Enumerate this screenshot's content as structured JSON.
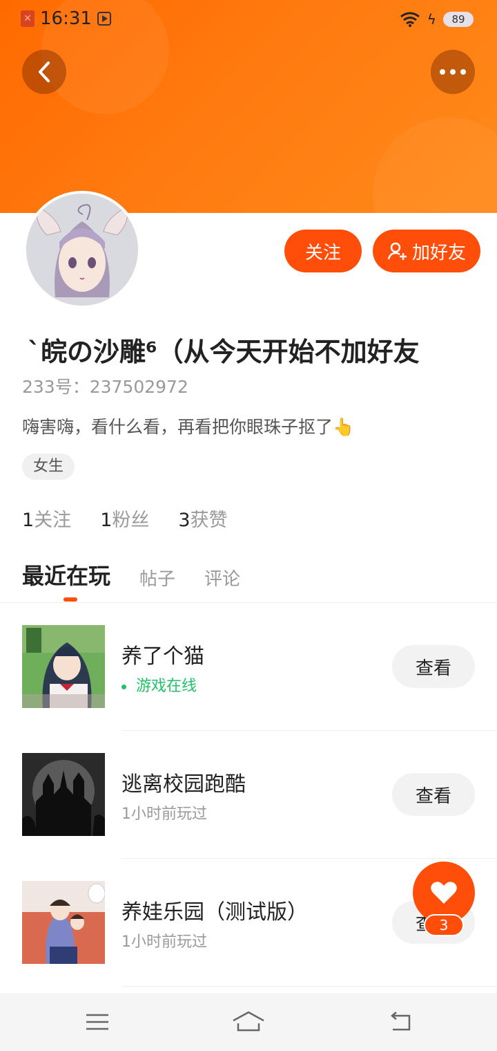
{
  "status_bar": {
    "time": "16:31",
    "battery": "89"
  },
  "profile": {
    "nickname": "ˋ皖の沙雕⁶（从今天开始不加好友",
    "uid": "233号：237502972",
    "bio": "嗨害嗨，看什么看，再看把你眼珠子抠了👆",
    "gender_tag": "女生",
    "follow_label": "关注",
    "add_friend_label": "加好友",
    "stats": [
      {
        "num": "1",
        "label": "关注"
      },
      {
        "num": "1",
        "label": "粉丝"
      },
      {
        "num": "3",
        "label": "获赞"
      }
    ]
  },
  "tabs": [
    "最近在玩",
    "帖子",
    "评论"
  ],
  "games": [
    {
      "title": "养了个猫",
      "sub": "游戏在线",
      "button": "查看"
    },
    {
      "title": "逃离校园跑酷",
      "sub": "1小时前玩过",
      "button": "查看"
    },
    {
      "title": "养娃乐园（测试版）",
      "sub": "1小时前玩过",
      "button": "查看"
    }
  ],
  "likes_count": "3",
  "icons": {
    "back": "chevron-left-icon",
    "more": "more-dots-icon",
    "add_friend": "add-user-icon",
    "heart": "heart-icon",
    "nav": [
      "menu-icon",
      "home-icon",
      "return-icon"
    ]
  },
  "colors": {
    "accent": "#ff4d0a",
    "banner": "#ff7a10",
    "online": "#22c06a"
  }
}
